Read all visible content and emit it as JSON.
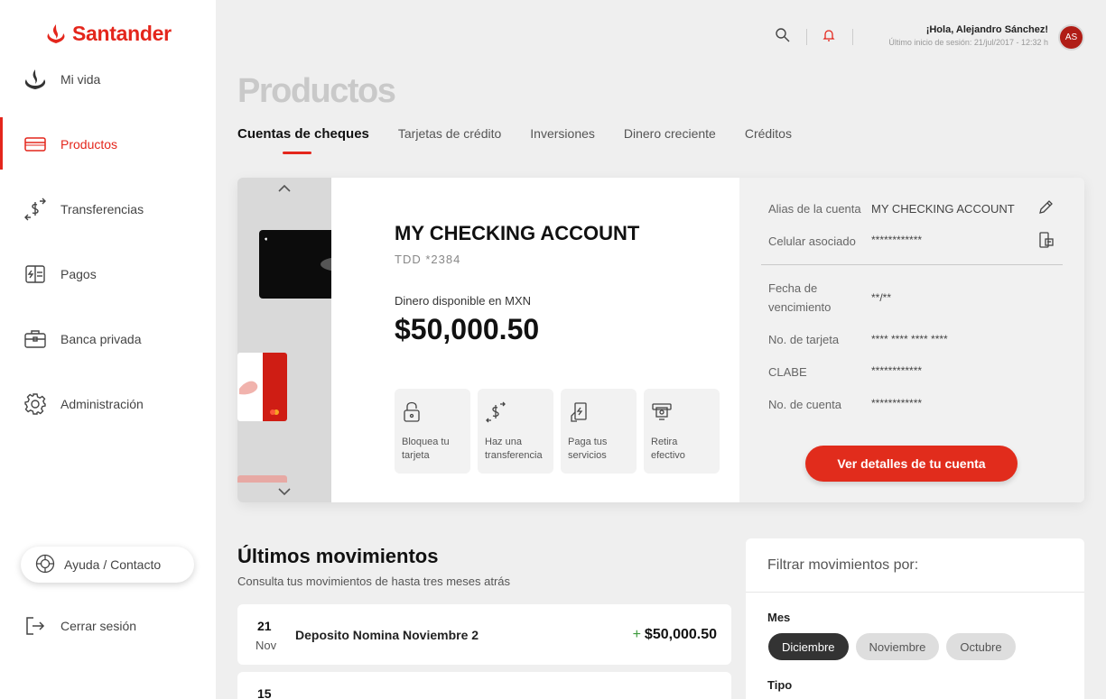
{
  "brand": {
    "name": "Santander",
    "color": "#e4261c"
  },
  "sidebar": {
    "items": [
      {
        "label": "Mi vida",
        "icon": "flame-logo-icon"
      },
      {
        "label": "Productos",
        "icon": "card-icon",
        "active": true
      },
      {
        "label": "Transferencias",
        "icon": "transfer-icon"
      },
      {
        "label": "Pagos",
        "icon": "payments-icon"
      },
      {
        "label": "Banca privada",
        "icon": "briefcase-icon"
      },
      {
        "label": "Administración",
        "icon": "gear-icon"
      }
    ],
    "help_label": "Ayuda / Contacto",
    "logout_label": "Cerrar sesión"
  },
  "header": {
    "greeting": "¡Hola, Alejandro Sánchez!",
    "last_login": "Último inicio de sesión: 21/jul/2017 - 12:32 h",
    "avatar_initials": "AS"
  },
  "page": {
    "title": "Productos",
    "tabs": [
      {
        "label": "Cuentas de cheques",
        "active": true
      },
      {
        "label": "Tarjetas de crédito"
      },
      {
        "label": "Inversiones"
      },
      {
        "label": "Dinero creciente"
      },
      {
        "label": "Créditos"
      }
    ]
  },
  "account": {
    "name": "MY CHECKING ACCOUNT",
    "number": "TDD *2384",
    "balance_label": "Dinero disponible en MXN",
    "balance": "$50,000.50",
    "actions": [
      {
        "label": "Bloquea tu tarjeta",
        "icon": "lock-icon"
      },
      {
        "label": "Haz una transferencia",
        "icon": "transfer-icon"
      },
      {
        "label": "Paga tus servicios",
        "icon": "pay-service-icon"
      },
      {
        "label": "Retira efectivo",
        "icon": "cash-withdraw-icon"
      }
    ]
  },
  "details": {
    "alias_label": "Alias de la cuenta",
    "alias_value": "MY CHECKING ACCOUNT",
    "phone_label": "Celular asociado",
    "phone_value": "************",
    "expiry_label_1": "Fecha de",
    "expiry_label_2": "vencimiento",
    "expiry_value": "**/**",
    "card_label": "No. de tarjeta",
    "card_value": "**** **** **** ****",
    "clabe_label": "CLABE",
    "clabe_value": "************",
    "account_label": "No. de cuenta",
    "account_value": "************",
    "cta_label": "Ver detalles de tu cuenta"
  },
  "movements": {
    "title": "Últimos movimientos",
    "subtitle": "Consulta tus movimientos de hasta tres meses atrás",
    "rows": [
      {
        "day": "21",
        "month": "Nov",
        "description": "Deposito Nomina Noviembre 2",
        "sign": "+",
        "amount": "$50,000.50"
      },
      {
        "day": "15",
        "month": "",
        "description": "",
        "sign": "",
        "amount": ""
      }
    ]
  },
  "filter": {
    "title": "Filtrar movimientos por:",
    "month_label": "Mes",
    "months": [
      {
        "label": "Diciembre",
        "selected": true
      },
      {
        "label": "Noviembre"
      },
      {
        "label": "Octubre"
      }
    ],
    "type_label": "Tipo"
  }
}
